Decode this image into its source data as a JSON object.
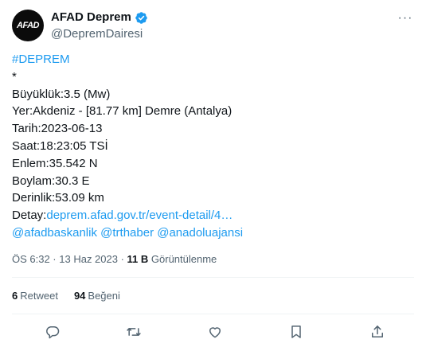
{
  "author": {
    "avatar_text": "AFAD",
    "display_name": "AFAD Deprem",
    "handle": "@DepremDairesi"
  },
  "tweet": {
    "hashtag": "#DEPREM",
    "asterisk": "*",
    "magnitude": "Büyüklük:3.5 (Mw)",
    "location": "Yer:Akdeniz - [81.77 km] Demre (Antalya)",
    "date": "Tarih:2023-06-13",
    "time": "Saat:18:23:05 TSİ",
    "latitude": "Enlem:35.542 N",
    "longitude": "Boylam:30.3 E",
    "depth": "Derinlik:53.09 km",
    "detail_label": "Detay:",
    "detail_link": "deprem.afad.gov.tr/event-detail/4…",
    "mentions": [
      "@afadbaskanlik",
      "@trthaber",
      "@anadoluajansi"
    ]
  },
  "meta": {
    "timestamp": "ÖS 6:32 · 13 Haz 2023 · ",
    "views_count": "11 B",
    "views_label": " Görüntülenme"
  },
  "stats": {
    "retweet_count": "6",
    "retweet_label": "Retweet",
    "like_count": "94",
    "like_label": "Beğeni"
  },
  "colors": {
    "link": "#1d9bf0",
    "secondary_text": "#536471",
    "verified_badge": "#1d9bf0"
  },
  "icons": [
    "verified-badge-icon",
    "more-icon",
    "reply-icon",
    "retweet-icon",
    "like-icon",
    "bookmark-icon",
    "share-icon"
  ]
}
